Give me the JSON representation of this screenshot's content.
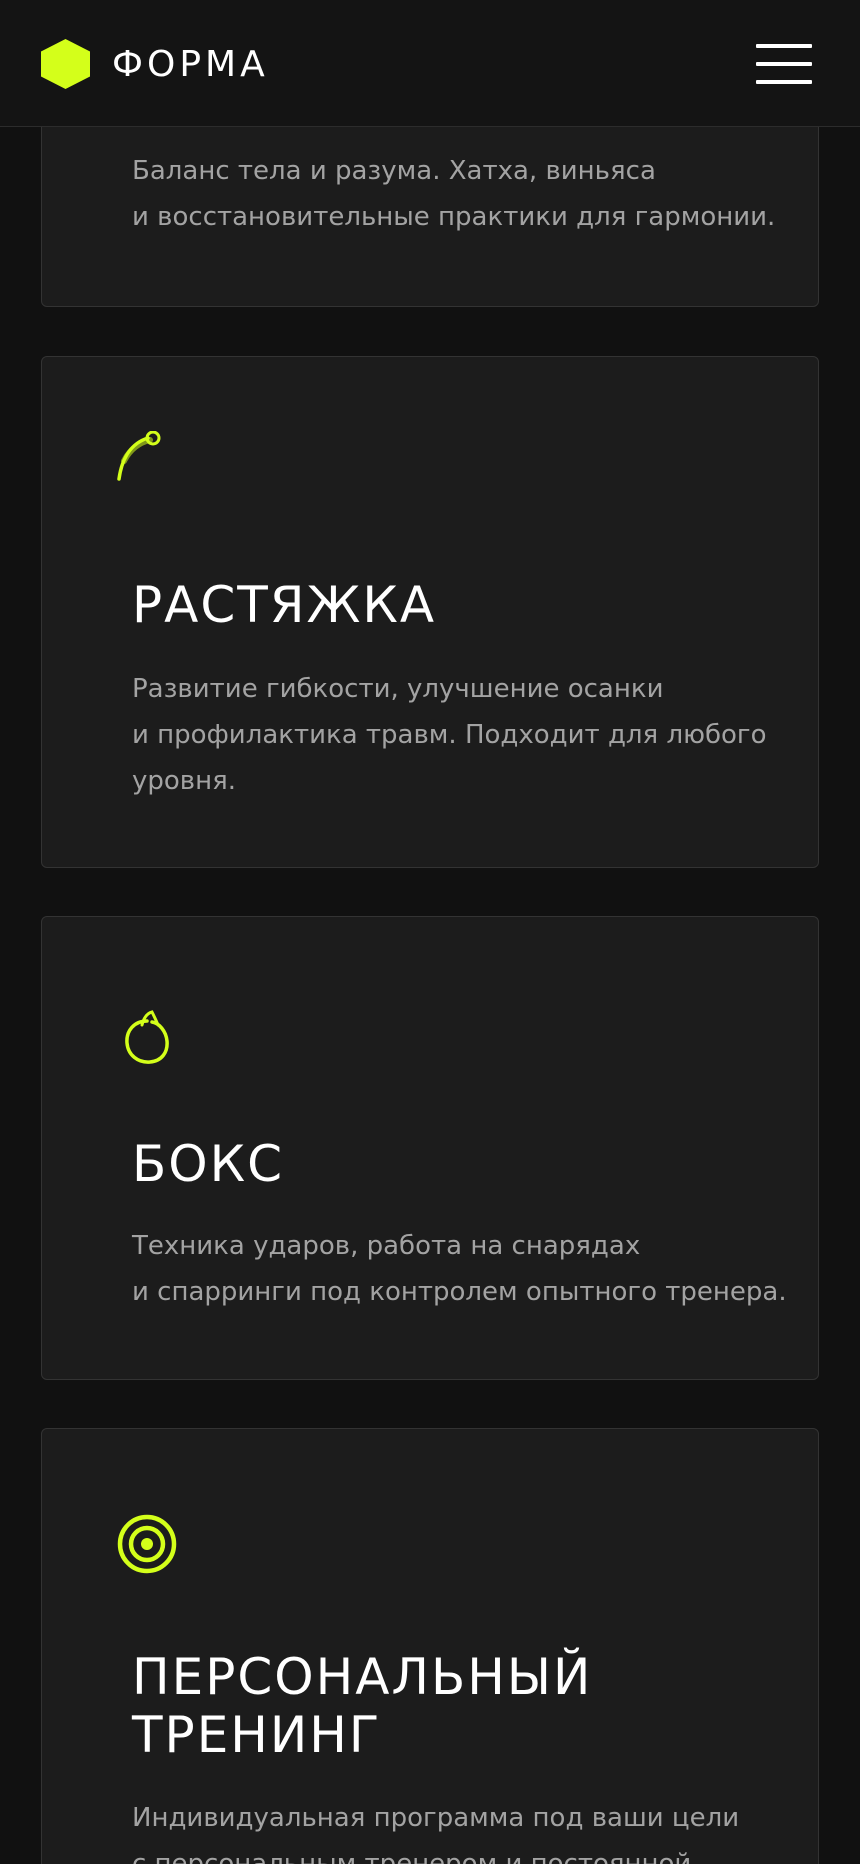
{
  "header": {
    "logo_text": "ФОРМА",
    "logo_icon": "hexagon-icon",
    "menu_icon": "hamburger-menu-icon"
  },
  "accent_color": "#d4ff1a",
  "cards": [
    {
      "icon": "yoga-icon",
      "title": "",
      "desc_line1": "Баланс тела и разума. Хатха, виньяса",
      "desc_line2": "и восстановительные практики для гармонии."
    },
    {
      "icon": "stretch-arc-icon",
      "title": "РАСТЯЖКА",
      "desc_line1": "Развитие гибкости, улучшение осанки",
      "desc_line2": "и профилактика травм. Подходит для любого",
      "desc_line3": "уровня."
    },
    {
      "icon": "boxing-glove-icon",
      "title": "БОКС",
      "desc_line1": "Техника ударов, работа на снарядах",
      "desc_line2": "и спарринги под контролем опытного тренера."
    },
    {
      "icon": "target-icon",
      "title_line1": "ПЕРСОНАЛЬНЫЙ",
      "title_line2": "ТРЕНИНГ",
      "desc_line1": "Индивидуальная программа под ваши цели",
      "desc_line2": "с персональным тренером и постоянной"
    }
  ]
}
